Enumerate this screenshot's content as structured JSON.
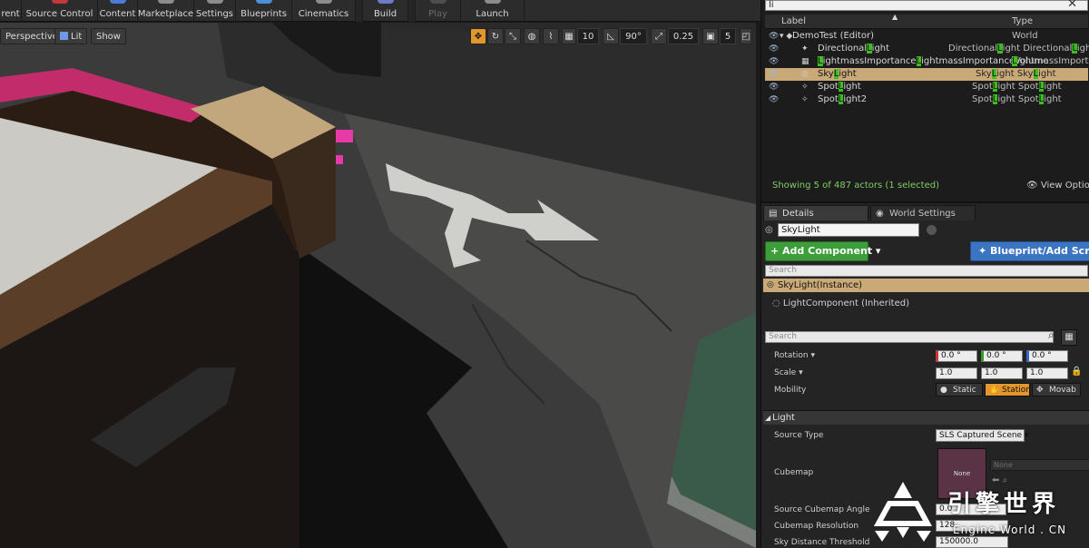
{
  "toolbar": {
    "items": [
      {
        "label": "rent",
        "icon": "content-icon"
      },
      {
        "label": "Source Control",
        "icon": "source-control-icon"
      },
      {
        "label": "Content",
        "icon": "content-browser-icon"
      },
      {
        "label": "Marketplace",
        "icon": "marketplace-icon"
      },
      {
        "label": "Settings",
        "icon": "settings-icon"
      },
      {
        "label": "Blueprints",
        "icon": "blueprints-icon"
      },
      {
        "label": "Cinematics",
        "icon": "cinematics-icon"
      },
      {
        "label": "Build",
        "icon": "build-icon"
      },
      {
        "label": "Play",
        "icon": "play-icon"
      },
      {
        "label": "Launch",
        "icon": "launch-icon"
      }
    ]
  },
  "viewport": {
    "perspective_label": "Perspective",
    "lit_label": "Lit",
    "show_label": "Show",
    "grid_snap": "10",
    "rotation_snap": "90°",
    "scale_snap": "0.25",
    "camera_speed": "5"
  },
  "outliner": {
    "filter_value": "li",
    "col_label": "Label",
    "col_type": "Type",
    "rows": [
      {
        "name": "DemoTest (Editor)",
        "type": "World",
        "selected": false
      },
      {
        "name_parts": [
          "Directional",
          "L",
          "ight"
        ],
        "type_parts": [
          "Directional",
          "L",
          "ight Directional",
          "L",
          "ight"
        ],
        "selected": false
      },
      {
        "name_parts": [
          "",
          "L",
          "ightmassImportance",
          "L",
          "ightmassImportanceVolume "
        ],
        "type_parts": [
          "",
          "L",
          "ightmassImportance"
        ],
        "selected": false
      },
      {
        "name_parts": [
          "Sky",
          "L",
          "ight"
        ],
        "type_parts": [
          "Sky",
          "L",
          "ight Sky",
          "L",
          "ight"
        ],
        "selected": true
      },
      {
        "name_parts": [
          "Spot",
          "L",
          "ight"
        ],
        "type_parts": [
          "Spot",
          "L",
          "ight Spot",
          "L",
          "ight"
        ],
        "selected": false
      },
      {
        "name_parts": [
          "Spot",
          "L",
          "ight2"
        ],
        "type_parts": [
          "Spot",
          "L",
          "ight Spot",
          "L",
          "ight"
        ],
        "selected": false
      }
    ],
    "status": "Showing 5 of 487 actors (1 selected)",
    "view_options": "View Options"
  },
  "details": {
    "tab_details": "Details",
    "tab_world_settings": "World Settings",
    "actor_name": "SkyLight",
    "add_component": "+ Add Component ▾",
    "blueprint_button": "Blueprint/Add Script",
    "search_placeholder": "Search",
    "component_root": "SkyLight(Instance)",
    "component_child": "LightComponent (Inherited)",
    "props_search_placeholder": "Search",
    "rotation_label": "Rotation ▾",
    "rotation": [
      "0.0 °",
      "0.0 °",
      "0.0 °"
    ],
    "scale_label": "Scale ▾",
    "scale": [
      "1.0",
      "1.0",
      "1.0"
    ],
    "mobility_label": "Mobility",
    "mobility": [
      "Static",
      "Station",
      "Movab"
    ],
    "section_light": "Light",
    "source_type_label": "Source Type",
    "source_type_value": "SLS Captured Scene ▾",
    "cubemap_label": "Cubemap",
    "cubemap_thumb": "None",
    "cubemap_value": "None",
    "source_cubemap_angle_label": "Source Cubemap Angle",
    "source_cubemap_angle_value": "0.0",
    "cubemap_resolution_label": "Cubemap Resolution",
    "cubemap_resolution_value": "128",
    "sky_distance_label": "Sky Distance Threshold",
    "sky_distance_value": "150000.0"
  },
  "watermark": {
    "title": "引擎世界",
    "subtitle": "Engine World . CN"
  },
  "colors": {
    "accent_orange": "#e2962c",
    "selection_tan": "#c9a978",
    "add_green": "#3b9e38",
    "blueprint_blue": "#3b74c2",
    "filter_highlight": "#3cbf1e"
  }
}
